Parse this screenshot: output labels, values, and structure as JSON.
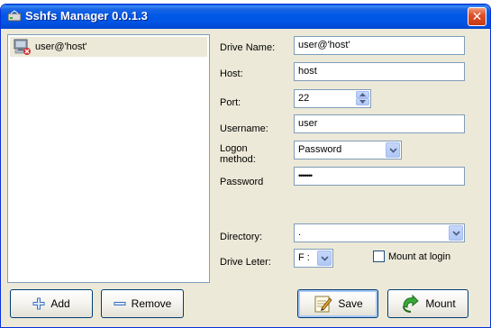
{
  "window": {
    "title": "Sshfs Manager 0.0.1.3",
    "close_glyph": "✕",
    "title_icon": "drive-icon"
  },
  "connections": {
    "items": [
      {
        "label": "user@'host'",
        "icon": "computer-disconnected-icon"
      }
    ]
  },
  "form": {
    "drive_name_label": "Drive Name:",
    "drive_name_value": "user@'host'",
    "host_label": "Host:",
    "host_value": "host",
    "port_label": "Port:",
    "port_value": "22",
    "username_label": "Username:",
    "username_value": "user",
    "logon_method_label_1": "Logon",
    "logon_method_label_2": "method:",
    "logon_method_value": "Password",
    "password_label": "Password",
    "password_value": "•••••••",
    "directory_label": "Directory:",
    "directory_value": ".",
    "drive_letter_label": "Drive Leter:",
    "drive_letter_value": "F :",
    "mount_at_login_label": "Mount at login",
    "mount_at_login_checked": false
  },
  "buttons": {
    "add": "Add",
    "remove": "Remove",
    "save": "Save",
    "mount": "Mount"
  },
  "colors": {
    "titlebar": "#0058e6",
    "face": "#ece9d8",
    "border": "#7f9db9"
  }
}
